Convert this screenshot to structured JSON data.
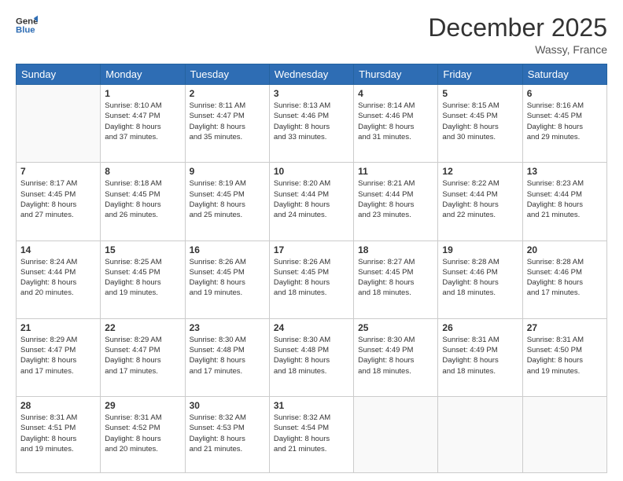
{
  "header": {
    "logo_line1": "General",
    "logo_line2": "Blue",
    "main_title": "December 2025",
    "subtitle": "Wassy, France"
  },
  "days_of_week": [
    "Sunday",
    "Monday",
    "Tuesday",
    "Wednesday",
    "Thursday",
    "Friday",
    "Saturday"
  ],
  "weeks": [
    [
      {
        "day": "",
        "info": ""
      },
      {
        "day": "1",
        "info": "Sunrise: 8:10 AM\nSunset: 4:47 PM\nDaylight: 8 hours\nand 37 minutes."
      },
      {
        "day": "2",
        "info": "Sunrise: 8:11 AM\nSunset: 4:47 PM\nDaylight: 8 hours\nand 35 minutes."
      },
      {
        "day": "3",
        "info": "Sunrise: 8:13 AM\nSunset: 4:46 PM\nDaylight: 8 hours\nand 33 minutes."
      },
      {
        "day": "4",
        "info": "Sunrise: 8:14 AM\nSunset: 4:46 PM\nDaylight: 8 hours\nand 31 minutes."
      },
      {
        "day": "5",
        "info": "Sunrise: 8:15 AM\nSunset: 4:45 PM\nDaylight: 8 hours\nand 30 minutes."
      },
      {
        "day": "6",
        "info": "Sunrise: 8:16 AM\nSunset: 4:45 PM\nDaylight: 8 hours\nand 29 minutes."
      }
    ],
    [
      {
        "day": "7",
        "info": "Sunrise: 8:17 AM\nSunset: 4:45 PM\nDaylight: 8 hours\nand 27 minutes."
      },
      {
        "day": "8",
        "info": "Sunrise: 8:18 AM\nSunset: 4:45 PM\nDaylight: 8 hours\nand 26 minutes."
      },
      {
        "day": "9",
        "info": "Sunrise: 8:19 AM\nSunset: 4:45 PM\nDaylight: 8 hours\nand 25 minutes."
      },
      {
        "day": "10",
        "info": "Sunrise: 8:20 AM\nSunset: 4:44 PM\nDaylight: 8 hours\nand 24 minutes."
      },
      {
        "day": "11",
        "info": "Sunrise: 8:21 AM\nSunset: 4:44 PM\nDaylight: 8 hours\nand 23 minutes."
      },
      {
        "day": "12",
        "info": "Sunrise: 8:22 AM\nSunset: 4:44 PM\nDaylight: 8 hours\nand 22 minutes."
      },
      {
        "day": "13",
        "info": "Sunrise: 8:23 AM\nSunset: 4:44 PM\nDaylight: 8 hours\nand 21 minutes."
      }
    ],
    [
      {
        "day": "14",
        "info": "Sunrise: 8:24 AM\nSunset: 4:44 PM\nDaylight: 8 hours\nand 20 minutes."
      },
      {
        "day": "15",
        "info": "Sunrise: 8:25 AM\nSunset: 4:45 PM\nDaylight: 8 hours\nand 19 minutes."
      },
      {
        "day": "16",
        "info": "Sunrise: 8:26 AM\nSunset: 4:45 PM\nDaylight: 8 hours\nand 19 minutes."
      },
      {
        "day": "17",
        "info": "Sunrise: 8:26 AM\nSunset: 4:45 PM\nDaylight: 8 hours\nand 18 minutes."
      },
      {
        "day": "18",
        "info": "Sunrise: 8:27 AM\nSunset: 4:45 PM\nDaylight: 8 hours\nand 18 minutes."
      },
      {
        "day": "19",
        "info": "Sunrise: 8:28 AM\nSunset: 4:46 PM\nDaylight: 8 hours\nand 18 minutes."
      },
      {
        "day": "20",
        "info": "Sunrise: 8:28 AM\nSunset: 4:46 PM\nDaylight: 8 hours\nand 17 minutes."
      }
    ],
    [
      {
        "day": "21",
        "info": "Sunrise: 8:29 AM\nSunset: 4:47 PM\nDaylight: 8 hours\nand 17 minutes."
      },
      {
        "day": "22",
        "info": "Sunrise: 8:29 AM\nSunset: 4:47 PM\nDaylight: 8 hours\nand 17 minutes."
      },
      {
        "day": "23",
        "info": "Sunrise: 8:30 AM\nSunset: 4:48 PM\nDaylight: 8 hours\nand 17 minutes."
      },
      {
        "day": "24",
        "info": "Sunrise: 8:30 AM\nSunset: 4:48 PM\nDaylight: 8 hours\nand 18 minutes."
      },
      {
        "day": "25",
        "info": "Sunrise: 8:30 AM\nSunset: 4:49 PM\nDaylight: 8 hours\nand 18 minutes."
      },
      {
        "day": "26",
        "info": "Sunrise: 8:31 AM\nSunset: 4:49 PM\nDaylight: 8 hours\nand 18 minutes."
      },
      {
        "day": "27",
        "info": "Sunrise: 8:31 AM\nSunset: 4:50 PM\nDaylight: 8 hours\nand 19 minutes."
      }
    ],
    [
      {
        "day": "28",
        "info": "Sunrise: 8:31 AM\nSunset: 4:51 PM\nDaylight: 8 hours\nand 19 minutes."
      },
      {
        "day": "29",
        "info": "Sunrise: 8:31 AM\nSunset: 4:52 PM\nDaylight: 8 hours\nand 20 minutes."
      },
      {
        "day": "30",
        "info": "Sunrise: 8:32 AM\nSunset: 4:53 PM\nDaylight: 8 hours\nand 21 minutes."
      },
      {
        "day": "31",
        "info": "Sunrise: 8:32 AM\nSunset: 4:54 PM\nDaylight: 8 hours\nand 21 minutes."
      },
      {
        "day": "",
        "info": ""
      },
      {
        "day": "",
        "info": ""
      },
      {
        "day": "",
        "info": ""
      }
    ]
  ]
}
